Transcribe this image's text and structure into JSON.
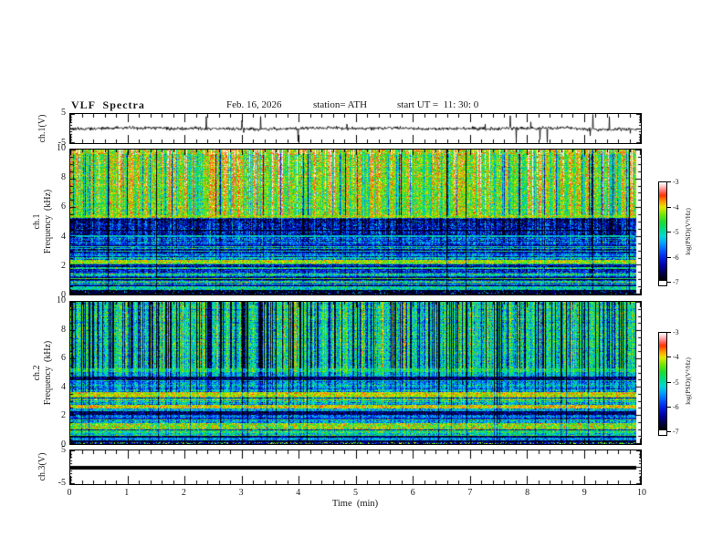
{
  "title": {
    "main": "VLF  Spectra",
    "date": "Feb. 16, 2026",
    "station": "station= ATH",
    "start_ut": "start UT =  11: 30: 0"
  },
  "xaxis": {
    "title": "Time  (min)",
    "ticks": [
      "0",
      "1",
      "2",
      "3",
      "4",
      "5",
      "6",
      "7",
      "8",
      "9",
      "10"
    ]
  },
  "panels": {
    "ch1_wave": {
      "ylabel": "ch.1(V)",
      "ytick_top": "5",
      "ytick_bottom": "-5"
    },
    "spec1": {
      "ylabel_channel": "ch.1",
      "ylabel_axis": "Frequency  (kHz)",
      "yticks": [
        "10",
        "8",
        "6",
        "4",
        "2",
        "0"
      ]
    },
    "spec2": {
      "ylabel_channel": "ch.2",
      "ylabel_axis": "Frequency  (kHz)",
      "yticks": [
        "10",
        "8",
        "6",
        "4",
        "2",
        "0"
      ]
    },
    "ch3_wave": {
      "ylabel": "ch.3(V)",
      "ytick_top": "5",
      "ytick_bottom": "-5"
    }
  },
  "colorbar": {
    "label": "log(PSD)(V²/Hz)",
    "ticks": [
      "-3",
      "-4",
      "-5",
      "-6",
      "-7"
    ]
  },
  "colors": {
    "frame": "#000000",
    "background": "#ffffff",
    "trace": "#000000",
    "colormap_stops": [
      [
        0.0,
        "#000000"
      ],
      [
        0.06,
        "#02023a"
      ],
      [
        0.14,
        "#00009a"
      ],
      [
        0.22,
        "#0018e0"
      ],
      [
        0.3,
        "#0055ff"
      ],
      [
        0.38,
        "#00a0ff"
      ],
      [
        0.45,
        "#00d8d8"
      ],
      [
        0.52,
        "#00dd88"
      ],
      [
        0.6,
        "#1edd2e"
      ],
      [
        0.68,
        "#7ae800"
      ],
      [
        0.75,
        "#e8e800"
      ],
      [
        0.81,
        "#ff9900"
      ],
      [
        0.87,
        "#ff3300"
      ],
      [
        0.92,
        "#ff7777"
      ],
      [
        0.96,
        "#ffc0c0"
      ],
      [
        1.0,
        "#ffffff"
      ]
    ]
  },
  "chart_data": [
    {
      "type": "line",
      "name": "ch.1 voltage waveform",
      "ylabel": "ch.1(V)",
      "xlim_min": [
        0,
        10
      ],
      "ylim_v": [
        -5,
        5
      ],
      "description": "Dense noisy voltage trace centered on 0 V, typical excursions ±1 V, with frequent impulsive spikes reaching ±2 to ±5 V; data extends from 0 to about 9.87 min."
    },
    {
      "type": "heatmap",
      "name": "ch.1 VLF spectrogram",
      "ylabel": "ch.1 Frequency (kHz)",
      "xlim_min": [
        0,
        10
      ],
      "ylim_khz": [
        0,
        10
      ],
      "zlabel": "log(PSD)(V²/Hz)",
      "zlim": [
        -7,
        -3
      ],
      "features": [
        "5.4-10 kHz: green background (~ -4.5) with strong vertical streaks: yellow/orange/red bursts and dark-blue/black dropout columns",
        "intense red/orange speckle near 9.7-10 kHz",
        "bright yellow-green horizontal line near 5.35 kHz",
        "3.9-5.3 kHz: dark blue band (~ -6.3) with black speckle and green vertical streaks",
        "2.4-3.9 kHz: blue/cyan horizontally striped noise",
        "yellow-green horizontal band near 2.25 kHz",
        "dark band with orange line near 1.05 kHz",
        "black band below 0.3 kHz"
      ]
    },
    {
      "type": "heatmap",
      "name": "ch.2 VLF spectrogram",
      "ylabel": "ch.2 Frequency (kHz)",
      "xlim_min": [
        0,
        10
      ],
      "ylim_khz": [
        0,
        10
      ],
      "zlabel": "log(PSD)(V²/Hz)",
      "zlim": [
        -7,
        -3
      ],
      "features": [
        "5.3-10 kHz: green/cyan background with many dark-blue vertical streaks and thin black dropout columns",
        "dark horizontal band with thin orange line near 4.6 kHz",
        "orange/red horizontal band near 3.45 kHz",
        "orange-yellow line near 2.6 kHz and dark double line near 2.1 kHz",
        "yellow band with orange speckle near 1.0-1.4 kHz",
        "black horizontal lines near 0.4-0.5 kHz and dark reddish line at the bottom edge"
      ]
    },
    {
      "type": "line",
      "name": "ch.3 voltage waveform",
      "ylabel": "ch.3(V)",
      "xlim_min": [
        0,
        10
      ],
      "ylim_v": [
        -5,
        5
      ],
      "value_v": 0,
      "description": "Flat thick black line at exactly 0 V across the whole record (no signal)."
    }
  ],
  "render": {
    "seeds": {
      "wave1": 42,
      "spec1": 1234,
      "spec2": 987,
      "colstreak1": 77,
      "colstreak2": 311
    },
    "spec1": {
      "bands": [
        {
          "flo": 9.7,
          "fhi": 10.01,
          "base": -4.15,
          "sw": 0.5,
          "nz": 0.5,
          "hw": 0.9
        },
        {
          "flo": 5.45,
          "fhi": 9.7,
          "base": -4.45,
          "sw": 0.85,
          "nz": 0.4,
          "rn": 0.06,
          "hwAuto": true
        },
        {
          "flo": 5.28,
          "fhi": 5.45,
          "base": -4.2,
          "sw": 0.3,
          "nz": 0.35,
          "sp": 0.06,
          "spv": -3.7
        },
        {
          "flo": 3.92,
          "fhi": 5.28,
          "base": -6.3,
          "sw": 0.62,
          "nz": 0.5,
          "rn": 0.12
        },
        {
          "flo": 3.5,
          "fhi": 3.92,
          "base": -5.85,
          "sw": 0.45,
          "nz": 0.5,
          "rn": 0.22
        },
        {
          "flo": 2.38,
          "fhi": 3.5,
          "base": -5.75,
          "sw": 0.3,
          "nz": 0.45,
          "rn": 0.3
        },
        {
          "flo": 2.14,
          "fhi": 2.38,
          "base": -4.15,
          "sw": 0.15,
          "nz": 0.35
        },
        {
          "flo": 1.22,
          "fhi": 2.14,
          "base": -5.55,
          "sw": 0.25,
          "nz": 0.45,
          "rn": 0.3
        },
        {
          "flo": 0.93,
          "fhi": 1.22,
          "base": -6.35,
          "sw": 0.12,
          "nz": 0.45,
          "rn": 0.2
        },
        {
          "flo": 0.46,
          "fhi": 0.93,
          "base": -5.45,
          "sw": 0.2,
          "nz": 0.45,
          "rn": 0.25
        },
        {
          "flo": 0.3,
          "fhi": 0.46,
          "base": -5.05,
          "sw": 0.15,
          "nz": 0.4
        },
        {
          "flo": 0,
          "fhi": 0.3,
          "base": -6.85,
          "sw": 0.05,
          "nz": 0.3,
          "sp": 0.05,
          "spv": -5.3
        }
      ],
      "lines": [
        {
          "f": 4.44,
          "hw": 0.05,
          "v": -6.9
        },
        {
          "f": 4.02,
          "hw": 0.05,
          "v": -5.25
        },
        {
          "f": 3.36,
          "hw": 0.04,
          "v": -6.5
        },
        {
          "f": 1.07,
          "hw": 0.05,
          "v": -4.6
        },
        {
          "f": 0.55,
          "hw": 0.03,
          "v": -6.6
        }
      ],
      "colp": {
        "drop": 0.02,
        "dark": 0.08,
        "darkAmp": 1.6,
        "hot": 0.3,
        "hotAmp": 1.3,
        "gstd": 0.9
      }
    },
    "spec2": {
      "bands": [
        {
          "flo": 5.35,
          "fhi": 10.01,
          "base": -5.0,
          "sw": 0.95,
          "nz": 0.45,
          "rn": 0.06,
          "hw": 0.2
        },
        {
          "flo": 5.08,
          "fhi": 5.35,
          "base": -4.7,
          "sw": 0.4,
          "nz": 0.35
        },
        {
          "flo": 4.72,
          "fhi": 5.08,
          "base": -5.2,
          "sw": 0.5,
          "nz": 0.4
        },
        {
          "flo": 4.5,
          "fhi": 4.72,
          "base": -6.55,
          "sw": 0.2,
          "nz": 0.45
        },
        {
          "flo": 3.62,
          "fhi": 4.5,
          "base": -5.15,
          "sw": 0.35,
          "nz": 0.45,
          "rn": 0.2
        },
        {
          "flo": 3.32,
          "fhi": 3.62,
          "base": -3.95,
          "sw": 0.2,
          "nz": 0.35
        },
        {
          "flo": 2.72,
          "fhi": 3.32,
          "base": -5.2,
          "sw": 0.3,
          "nz": 0.45,
          "rn": 0.25
        },
        {
          "flo": 2.5,
          "fhi": 2.72,
          "base": -4.0,
          "sw": 0.15,
          "nz": 0.4
        },
        {
          "flo": 2.26,
          "fhi": 2.5,
          "base": -5.3,
          "sw": 0.15,
          "nz": 0.45
        },
        {
          "flo": 2.04,
          "fhi": 2.26,
          "base": -6.6,
          "sw": 0.1,
          "nz": 0.4
        },
        {
          "flo": 1.42,
          "fhi": 2.04,
          "base": -5.25,
          "sw": 0.2,
          "nz": 0.45,
          "rn": 0.25
        },
        {
          "flo": 0.97,
          "fhi": 1.42,
          "base": -4.3,
          "sw": 0.15,
          "nz": 0.5,
          "sp": 0.08,
          "spv": -3.8
        },
        {
          "flo": 0.56,
          "fhi": 0.97,
          "base": -5.3,
          "sw": 0.15,
          "nz": 0.45,
          "rn": 0.2
        },
        {
          "flo": 0.4,
          "fhi": 0.56,
          "base": -6.7,
          "sw": 0.1,
          "nz": 0.4
        },
        {
          "flo": 0.22,
          "fhi": 0.4,
          "base": -5.45,
          "sw": 0.1,
          "nz": 0.4
        },
        {
          "flo": 0.1,
          "fhi": 0.22,
          "base": -6.8,
          "sw": 0.05,
          "nz": 0.3
        },
        {
          "flo": 0,
          "fhi": 0.1,
          "base": -6.4,
          "sw": 0.05,
          "nz": 0.4,
          "sp": 0.25,
          "spv": -4.35
        }
      ],
      "lines": [
        {
          "f": 4.62,
          "hw": 0.025,
          "v": -4.8
        },
        {
          "f": 3.45,
          "hw": 0.04,
          "v": -4.1
        },
        {
          "f": 2.6,
          "hw": 0.03,
          "v": -3.8
        },
        {
          "f": 1.72,
          "hw": 0.04,
          "v": -6.25
        }
      ],
      "colp": {
        "drop": 0.03,
        "dark": 0.22,
        "darkAmp": 1.8,
        "hot": 0.08,
        "hotAmp": 0.8,
        "gstd": 0.8
      }
    },
    "wave": {
      "noise_std": 0.55,
      "spike_p": 0.018,
      "spike_amp": 3.3,
      "big_p": 0.003
    }
  }
}
